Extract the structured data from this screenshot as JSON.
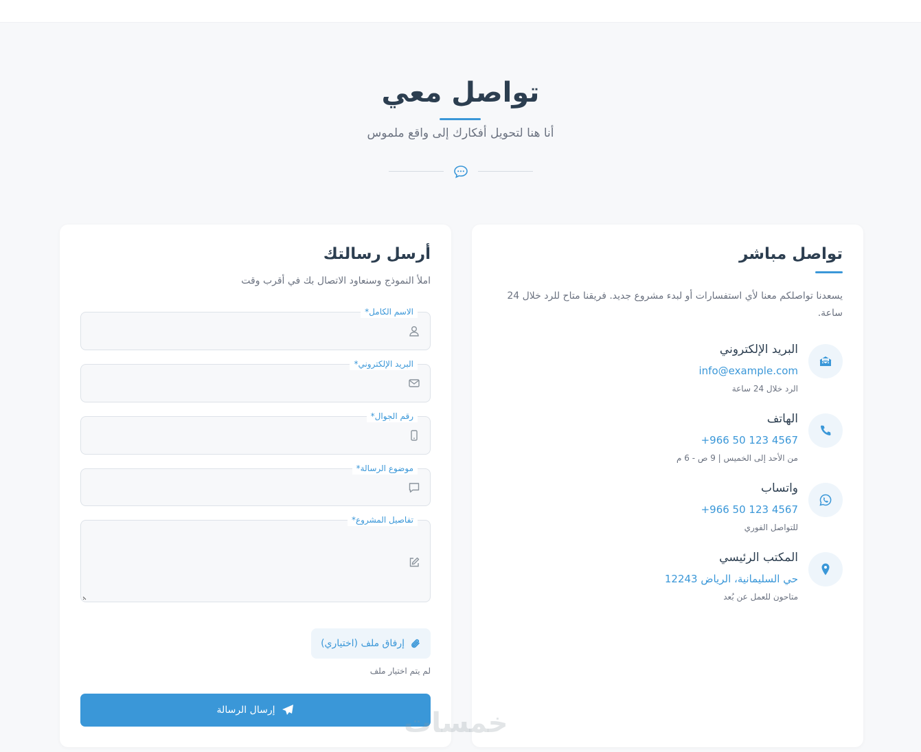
{
  "header": {
    "title": "تواصل معي",
    "subtitle": "أنا هنا لتحويل أفكارك إلى واقع ملموس"
  },
  "form": {
    "title": "أرسل رسالتك",
    "subtitle": "املأ النموذج وسنعاود الاتصال بك في أقرب وقت",
    "fields": [
      {
        "label": "الاسم الكامل*",
        "icon": "user-icon",
        "value": "",
        "placeholder": ""
      },
      {
        "label": "البريد الإلكتروني*",
        "icon": "envelope-icon",
        "value": "",
        "placeholder": ""
      },
      {
        "label": "رقم الجوال*",
        "icon": "mobile-icon",
        "value": "",
        "placeholder": ""
      },
      {
        "label": "موضوع الرسالة*",
        "icon": "message-icon",
        "value": "",
        "placeholder": ""
      },
      {
        "label": "تفاصيل المشروع*",
        "icon": "edit-icon",
        "value": "",
        "placeholder": ""
      }
    ],
    "attach_label": "إرفاق ملف (اختياري)",
    "no_file_text": "لم يتم اختيار ملف",
    "submit_label": "إرسال الرسالة"
  },
  "info": {
    "title": "تواصل مباشر",
    "description": "يسعدنا تواصلكم معنا لأي استفسارات أو لبدء مشروع جديد. فريقنا متاح للرد خلال 24 ساعة.",
    "contacts": [
      {
        "title": "البريد الإلكتروني",
        "value": "info@example.com",
        "note": "الرد خلال 24 ساعة",
        "icon": "envelope-open-icon"
      },
      {
        "title": "الهاتف",
        "value": "+966 50 123 4567",
        "note": "من الأحد إلى الخميس | 9 ص - 6 م",
        "icon": "phone-icon"
      },
      {
        "title": "واتساب",
        "value": "+966 50 123 4567",
        "note": "للتواصل الفوري",
        "icon": "whatsapp-icon"
      },
      {
        "title": "المكتب الرئيسي",
        "value": "حي السليمانية، الرياض 12243",
        "note": "متاحون للعمل عن بُعد",
        "icon": "location-icon"
      }
    ]
  },
  "watermark": "خمسات",
  "colors": {
    "accent": "#3a97d8",
    "heading": "#2c3e50",
    "muted": "#6b7280",
    "background": "#f7f8fa"
  }
}
